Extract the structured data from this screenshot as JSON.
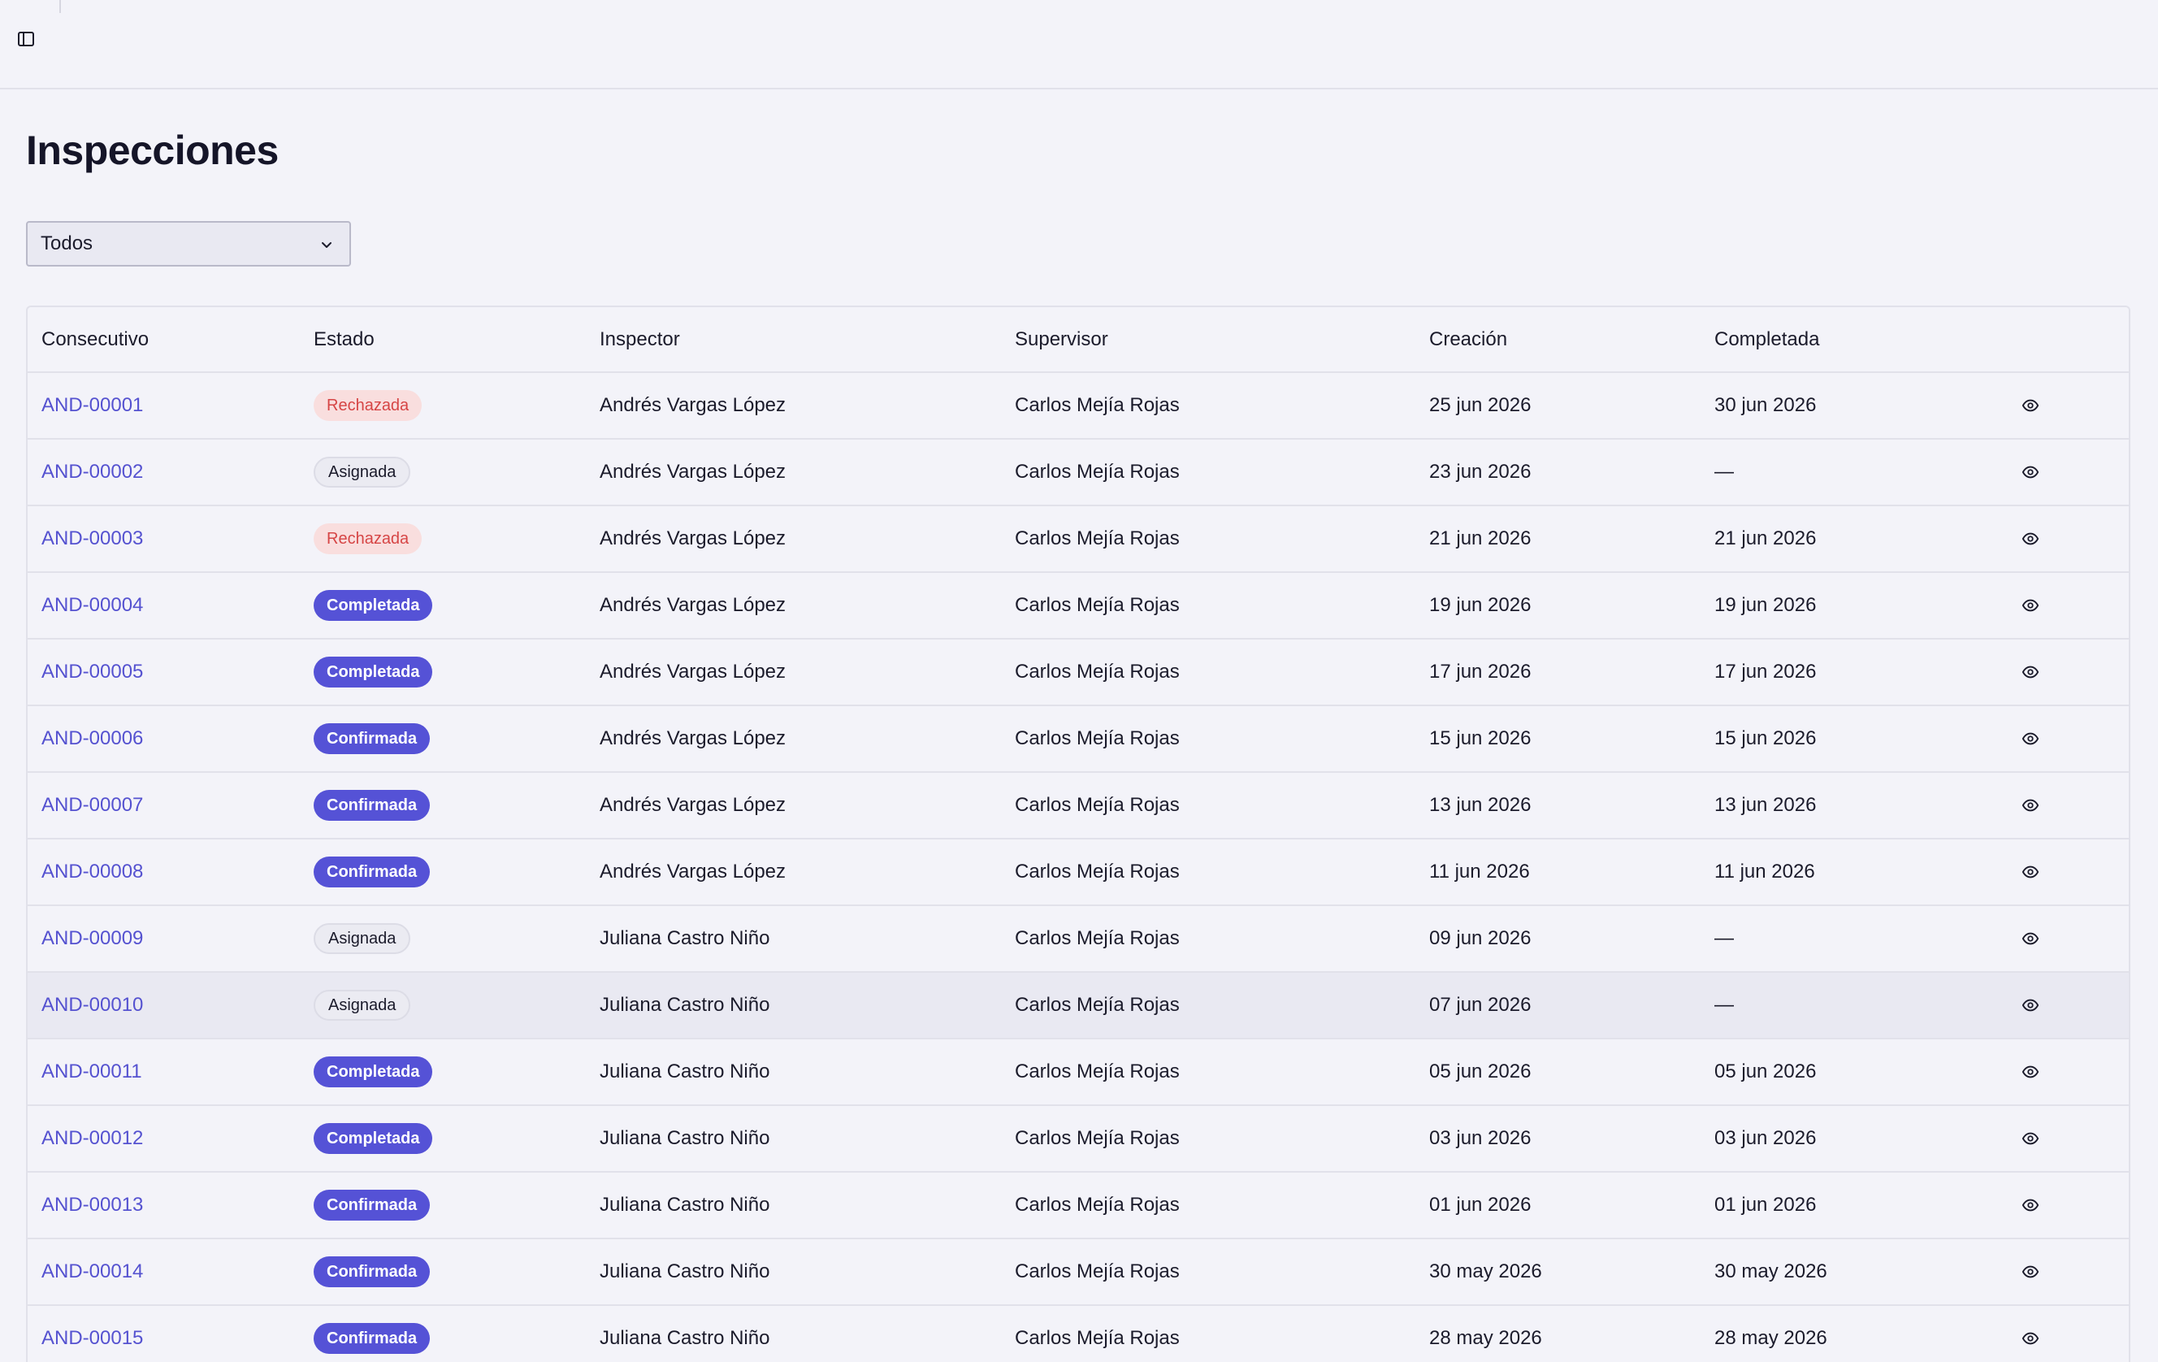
{
  "page": {
    "title": "Inspecciones"
  },
  "filter": {
    "selected": "Todos"
  },
  "table": {
    "headers": [
      "Consecutivo",
      "Estado",
      "Inspector",
      "Supervisor",
      "Creación",
      "Completada"
    ],
    "rows": [
      {
        "code": "AND-00001",
        "status": "Rechazada",
        "status_key": "rechazada",
        "inspector": "Andrés Vargas López",
        "supervisor": "Carlos Mejía Rojas",
        "created": "25 jun 2026",
        "completed": "30 jun 2026"
      },
      {
        "code": "AND-00002",
        "status": "Asignada",
        "status_key": "asignada",
        "inspector": "Andrés Vargas López",
        "supervisor": "Carlos Mejía Rojas",
        "created": "23 jun 2026",
        "completed": "—"
      },
      {
        "code": "AND-00003",
        "status": "Rechazada",
        "status_key": "rechazada",
        "inspector": "Andrés Vargas López",
        "supervisor": "Carlos Mejía Rojas",
        "created": "21 jun 2026",
        "completed": "21 jun 2026"
      },
      {
        "code": "AND-00004",
        "status": "Completada",
        "status_key": "completada",
        "inspector": "Andrés Vargas López",
        "supervisor": "Carlos Mejía Rojas",
        "created": "19 jun 2026",
        "completed": "19 jun 2026"
      },
      {
        "code": "AND-00005",
        "status": "Completada",
        "status_key": "completada",
        "inspector": "Andrés Vargas López",
        "supervisor": "Carlos Mejía Rojas",
        "created": "17 jun 2026",
        "completed": "17 jun 2026"
      },
      {
        "code": "AND-00006",
        "status": "Confirmada",
        "status_key": "confirmada",
        "inspector": "Andrés Vargas López",
        "supervisor": "Carlos Mejía Rojas",
        "created": "15 jun 2026",
        "completed": "15 jun 2026"
      },
      {
        "code": "AND-00007",
        "status": "Confirmada",
        "status_key": "confirmada",
        "inspector": "Andrés Vargas López",
        "supervisor": "Carlos Mejía Rojas",
        "created": "13 jun 2026",
        "completed": "13 jun 2026"
      },
      {
        "code": "AND-00008",
        "status": "Confirmada",
        "status_key": "confirmada",
        "inspector": "Andrés Vargas López",
        "supervisor": "Carlos Mejía Rojas",
        "created": "11 jun 2026",
        "completed": "11 jun 2026"
      },
      {
        "code": "AND-00009",
        "status": "Asignada",
        "status_key": "asignada",
        "inspector": "Juliana Castro Niño",
        "supervisor": "Carlos Mejía Rojas",
        "created": "09 jun 2026",
        "completed": "—"
      },
      {
        "code": "AND-00010",
        "status": "Asignada",
        "status_key": "asignada",
        "inspector": "Juliana Castro Niño",
        "supervisor": "Carlos Mejía Rojas",
        "created": "07 jun 2026",
        "completed": "—"
      },
      {
        "code": "AND-00011",
        "status": "Completada",
        "status_key": "completada",
        "inspector": "Juliana Castro Niño",
        "supervisor": "Carlos Mejía Rojas",
        "created": "05 jun 2026",
        "completed": "05 jun 2026"
      },
      {
        "code": "AND-00012",
        "status": "Completada",
        "status_key": "completada",
        "inspector": "Juliana Castro Niño",
        "supervisor": "Carlos Mejía Rojas",
        "created": "03 jun 2026",
        "completed": "03 jun 2026"
      },
      {
        "code": "AND-00013",
        "status": "Confirmada",
        "status_key": "confirmada",
        "inspector": "Juliana Castro Niño",
        "supervisor": "Carlos Mejía Rojas",
        "created": "01 jun 2026",
        "completed": "01 jun 2026"
      },
      {
        "code": "AND-00014",
        "status": "Confirmada",
        "status_key": "confirmada",
        "inspector": "Juliana Castro Niño",
        "supervisor": "Carlos Mejía Rojas",
        "created": "30 may 2026",
        "completed": "30 may 2026"
      },
      {
        "code": "AND-00015",
        "status": "Confirmada",
        "status_key": "confirmada",
        "inspector": "Juliana Castro Niño",
        "supervisor": "Carlos Mejía Rojas",
        "created": "28 may 2026",
        "completed": "28 may 2026"
      }
    ],
    "row_action_icon": "eye-icon"
  },
  "colors": {
    "accent": "#5552d6",
    "link": "#5552d0",
    "rejected_bg": "#f9dede",
    "rejected_text": "#d64545",
    "background": "#f3f3f9"
  },
  "icons": {
    "sidebar_toggle": "sidebar-panel-icon",
    "filter_chevron": "chevron-down-icon"
  }
}
